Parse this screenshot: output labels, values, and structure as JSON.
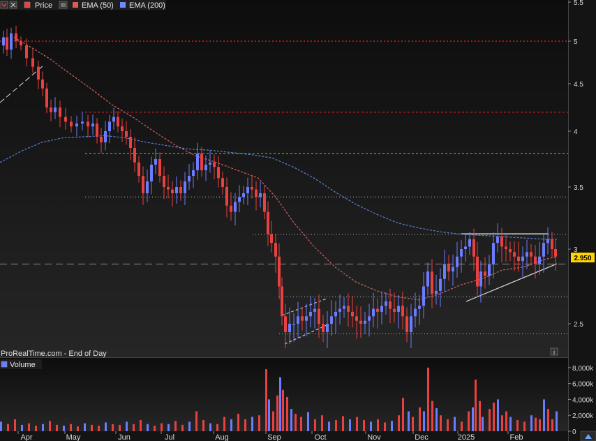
{
  "legend": {
    "price_label": "Price",
    "ema50_label": "EMA (50)",
    "ema200_label": "EMA (200)"
  },
  "source_text": "ProRealTime.com - End of Day",
  "volume_label": "Volume",
  "info_icon": "i",
  "colors": {
    "background": "#171717",
    "up": "#6b7cff",
    "down": "#e8413f",
    "ema50": "#d0635f",
    "ema200": "#5a82d8",
    "price_badge": "#ffd400",
    "red_level": "#dd1f1f",
    "green_level": "#22cc33"
  },
  "chart_data": {
    "type": "candlestick",
    "x_axis_months": [
      "Apr",
      "May",
      "Jun",
      "Jul",
      "Aug",
      "Sep",
      "Oct",
      "Nov",
      "Dec",
      "2025",
      "Feb"
    ],
    "price_ticks": [
      "5.5",
      "5",
      "4.5",
      "4",
      "3.5",
      "3",
      "2.5"
    ],
    "volume_ticks": [
      "8,000k",
      "6,000k",
      "4,000k",
      "2,000k",
      "0"
    ],
    "current_price": "2.950",
    "ylim": [
      2.3,
      5.5
    ],
    "volume_ylim": [
      0,
      8600
    ],
    "horizontal_levels": [
      {
        "value": 5.0,
        "style": "dotted-red"
      },
      {
        "value": 4.2,
        "style": "dashed-red"
      },
      {
        "value": 3.8,
        "style": "dashed-green"
      },
      {
        "value": 3.42,
        "style": "dotted-white"
      },
      {
        "value": 3.12,
        "style": "dotted-white"
      },
      {
        "value": 2.9,
        "style": "dashed-grey"
      },
      {
        "value": 2.68,
        "style": "dotted-white"
      },
      {
        "value": 2.44,
        "style": "dotted-white"
      }
    ],
    "price_points": [
      [
        0,
        4.95
      ],
      [
        6,
        5.05
      ],
      [
        10,
        4.9
      ],
      [
        18,
        5.1
      ],
      [
        24,
        5.0
      ],
      [
        32,
        4.95
      ],
      [
        40,
        4.8
      ],
      [
        50,
        4.7
      ],
      [
        56,
        4.55
      ],
      [
        62,
        4.45
      ],
      [
        68,
        4.25
      ],
      [
        74,
        4.2
      ],
      [
        80,
        4.25
      ],
      [
        88,
        4.15
      ],
      [
        96,
        4.1
      ],
      [
        104,
        4.05
      ],
      [
        112,
        4.08
      ],
      [
        120,
        4.1
      ],
      [
        128,
        4.05
      ],
      [
        134,
        4.08
      ],
      [
        140,
        3.95
      ],
      [
        146,
        3.9
      ],
      [
        152,
        4.0
      ],
      [
        158,
        4.1
      ],
      [
        164,
        4.15
      ],
      [
        170,
        4.05
      ],
      [
        176,
        4.0
      ],
      [
        182,
        3.95
      ],
      [
        188,
        3.85
      ],
      [
        194,
        3.72
      ],
      [
        200,
        3.6
      ],
      [
        206,
        3.45
      ],
      [
        212,
        3.55
      ],
      [
        218,
        3.7
      ],
      [
        224,
        3.75
      ],
      [
        230,
        3.6
      ],
      [
        236,
        3.5
      ],
      [
        242,
        3.48
      ],
      [
        248,
        3.45
      ],
      [
        254,
        3.5
      ],
      [
        260,
        3.45
      ],
      [
        266,
        3.55
      ],
      [
        272,
        3.6
      ],
      [
        278,
        3.65
      ],
      [
        284,
        3.8
      ],
      [
        290,
        3.65
      ],
      [
        296,
        3.7
      ],
      [
        302,
        3.72
      ],
      [
        308,
        3.68
      ],
      [
        314,
        3.58
      ],
      [
        320,
        3.5
      ],
      [
        326,
        3.35
      ],
      [
        332,
        3.3
      ],
      [
        338,
        3.38
      ],
      [
        344,
        3.42
      ],
      [
        350,
        3.45
      ],
      [
        356,
        3.5
      ],
      [
        362,
        3.48
      ],
      [
        368,
        3.42
      ],
      [
        374,
        3.45
      ],
      [
        380,
        3.3
      ],
      [
        384,
        3.12
      ],
      [
        390,
        3.05
      ],
      [
        396,
        2.95
      ],
      [
        400,
        2.75
      ],
      [
        404,
        2.55
      ],
      [
        410,
        2.45
      ],
      [
        416,
        2.5
      ],
      [
        422,
        2.5
      ],
      [
        428,
        2.55
      ],
      [
        434,
        2.52
      ],
      [
        440,
        2.55
      ],
      [
        446,
        2.58
      ],
      [
        452,
        2.6
      ],
      [
        458,
        2.5
      ],
      [
        464,
        2.45
      ],
      [
        470,
        2.5
      ],
      [
        476,
        2.55
      ],
      [
        482,
        2.58
      ],
      [
        488,
        2.6
      ],
      [
        494,
        2.62
      ],
      [
        500,
        2.58
      ],
      [
        506,
        2.55
      ],
      [
        512,
        2.52
      ],
      [
        518,
        2.5
      ],
      [
        524,
        2.52
      ],
      [
        530,
        2.55
      ],
      [
        536,
        2.6
      ],
      [
        542,
        2.58
      ],
      [
        548,
        2.62
      ],
      [
        554,
        2.65
      ],
      [
        560,
        2.6
      ],
      [
        566,
        2.58
      ],
      [
        572,
        2.62
      ],
      [
        578,
        2.55
      ],
      [
        584,
        2.45
      ],
      [
        590,
        2.55
      ],
      [
        596,
        2.6
      ],
      [
        602,
        2.62
      ],
      [
        608,
        2.75
      ],
      [
        614,
        2.85
      ],
      [
        620,
        2.7
      ],
      [
        626,
        2.72
      ],
      [
        632,
        2.8
      ],
      [
        638,
        2.9
      ],
      [
        644,
        2.85
      ],
      [
        650,
        2.88
      ],
      [
        656,
        2.95
      ],
      [
        662,
        3.0
      ],
      [
        668,
        3.02
      ],
      [
        674,
        3.08
      ],
      [
        680,
        2.95
      ],
      [
        684,
        2.75
      ],
      [
        690,
        2.85
      ],
      [
        696,
        2.82
      ],
      [
        702,
        2.9
      ],
      [
        708,
        3.05
      ],
      [
        714,
        3.1
      ],
      [
        720,
        3.02
      ],
      [
        726,
        3.0
      ],
      [
        732,
        2.98
      ],
      [
        738,
        2.95
      ],
      [
        744,
        2.92
      ],
      [
        750,
        2.95
      ],
      [
        756,
        2.98
      ],
      [
        762,
        2.95
      ],
      [
        768,
        2.9
      ],
      [
        774,
        2.95
      ],
      [
        780,
        3.05
      ],
      [
        786,
        3.08
      ],
      [
        792,
        3.0
      ],
      [
        796,
        2.95
      ]
    ],
    "volume_points": [
      [
        0,
        1200
      ],
      [
        10,
        900
      ],
      [
        20,
        1500
      ],
      [
        30,
        800
      ],
      [
        40,
        1000
      ],
      [
        50,
        700
      ],
      [
        60,
        900
      ],
      [
        70,
        1300
      ],
      [
        80,
        800
      ],
      [
        90,
        700
      ],
      [
        100,
        900
      ],
      [
        110,
        600
      ],
      [
        120,
        1000
      ],
      [
        130,
        800
      ],
      [
        140,
        700
      ],
      [
        150,
        1100
      ],
      [
        160,
        900
      ],
      [
        170,
        800
      ],
      [
        180,
        1200
      ],
      [
        190,
        900
      ],
      [
        200,
        1400
      ],
      [
        210,
        900
      ],
      [
        220,
        700
      ],
      [
        230,
        1000
      ],
      [
        240,
        900
      ],
      [
        250,
        1300
      ],
      [
        260,
        800
      ],
      [
        270,
        1200
      ],
      [
        280,
        2500
      ],
      [
        290,
        1400
      ],
      [
        300,
        1000
      ],
      [
        310,
        900
      ],
      [
        320,
        1800
      ],
      [
        330,
        1500
      ],
      [
        340,
        2200
      ],
      [
        350,
        1500
      ],
      [
        360,
        1800
      ],
      [
        370,
        2000
      ],
      [
        380,
        7800
      ],
      [
        384,
        4000
      ],
      [
        390,
        2500
      ],
      [
        396,
        4500
      ],
      [
        400,
        6800
      ],
      [
        404,
        5200
      ],
      [
        410,
        4300
      ],
      [
        416,
        2800
      ],
      [
        422,
        2200
      ],
      [
        430,
        1800
      ],
      [
        440,
        2400
      ],
      [
        450,
        1500
      ],
      [
        460,
        2000
      ],
      [
        470,
        1200
      ],
      [
        480,
        1400
      ],
      [
        490,
        1900
      ],
      [
        500,
        1500
      ],
      [
        510,
        1800
      ],
      [
        520,
        1400
      ],
      [
        530,
        1200
      ],
      [
        540,
        1500
      ],
      [
        550,
        1100
      ],
      [
        560,
        1300
      ],
      [
        570,
        2000
      ],
      [
        576,
        4200
      ],
      [
        584,
        2500
      ],
      [
        590,
        1800
      ],
      [
        600,
        3000
      ],
      [
        606,
        2500
      ],
      [
        612,
        8000
      ],
      [
        618,
        3800
      ],
      [
        624,
        2900
      ],
      [
        630,
        2000
      ],
      [
        640,
        1500
      ],
      [
        650,
        1800
      ],
      [
        660,
        1200
      ],
      [
        670,
        2500
      ],
      [
        676,
        3000
      ],
      [
        680,
        6500
      ],
      [
        686,
        3800
      ],
      [
        690,
        1800
      ],
      [
        700,
        2800
      ],
      [
        706,
        3600
      ],
      [
        712,
        4000
      ],
      [
        718,
        2000
      ],
      [
        724,
        2500
      ],
      [
        730,
        1800
      ],
      [
        740,
        1400
      ],
      [
        750,
        1200
      ],
      [
        760,
        2000
      ],
      [
        766,
        1700
      ],
      [
        772,
        1500
      ],
      [
        778,
        4000
      ],
      [
        784,
        2800
      ],
      [
        790,
        1500
      ],
      [
        796,
        2500
      ]
    ],
    "ema50_points": [
      [
        20,
        5.05
      ],
      [
        40,
        4.95
      ],
      [
        70,
        4.8
      ],
      [
        100,
        4.62
      ],
      [
        130,
        4.45
      ],
      [
        160,
        4.28
      ],
      [
        190,
        4.15
      ],
      [
        220,
        4.0
      ],
      [
        250,
        3.88
      ],
      [
        280,
        3.78
      ],
      [
        310,
        3.72
      ],
      [
        340,
        3.65
      ],
      [
        370,
        3.58
      ],
      [
        395,
        3.42
      ],
      [
        420,
        3.22
      ],
      [
        450,
        3.02
      ],
      [
        480,
        2.88
      ],
      [
        510,
        2.78
      ],
      [
        540,
        2.72
      ],
      [
        570,
        2.68
      ],
      [
        600,
        2.66
      ],
      [
        630,
        2.7
      ],
      [
        660,
        2.76
      ],
      [
        690,
        2.8
      ],
      [
        720,
        2.86
      ],
      [
        750,
        2.88
      ],
      [
        780,
        2.93
      ],
      [
        798,
        2.95
      ]
    ],
    "ema200_points": [
      [
        0,
        3.72
      ],
      [
        30,
        3.82
      ],
      [
        60,
        3.9
      ],
      [
        90,
        3.94
      ],
      [
        120,
        3.95
      ],
      [
        150,
        3.96
      ],
      [
        180,
        3.94
      ],
      [
        210,
        3.9
      ],
      [
        240,
        3.87
      ],
      [
        270,
        3.84
      ],
      [
        300,
        3.83
      ],
      [
        330,
        3.81
      ],
      [
        360,
        3.79
      ],
      [
        390,
        3.76
      ],
      [
        420,
        3.68
      ],
      [
        450,
        3.58
      ],
      [
        480,
        3.46
      ],
      [
        510,
        3.36
      ],
      [
        540,
        3.28
      ],
      [
        570,
        3.21
      ],
      [
        600,
        3.17
      ],
      [
        630,
        3.14
      ],
      [
        660,
        3.12
      ],
      [
        690,
        3.11
      ],
      [
        720,
        3.1
      ],
      [
        750,
        3.09
      ],
      [
        780,
        3.08
      ],
      [
        798,
        3.08
      ]
    ]
  }
}
